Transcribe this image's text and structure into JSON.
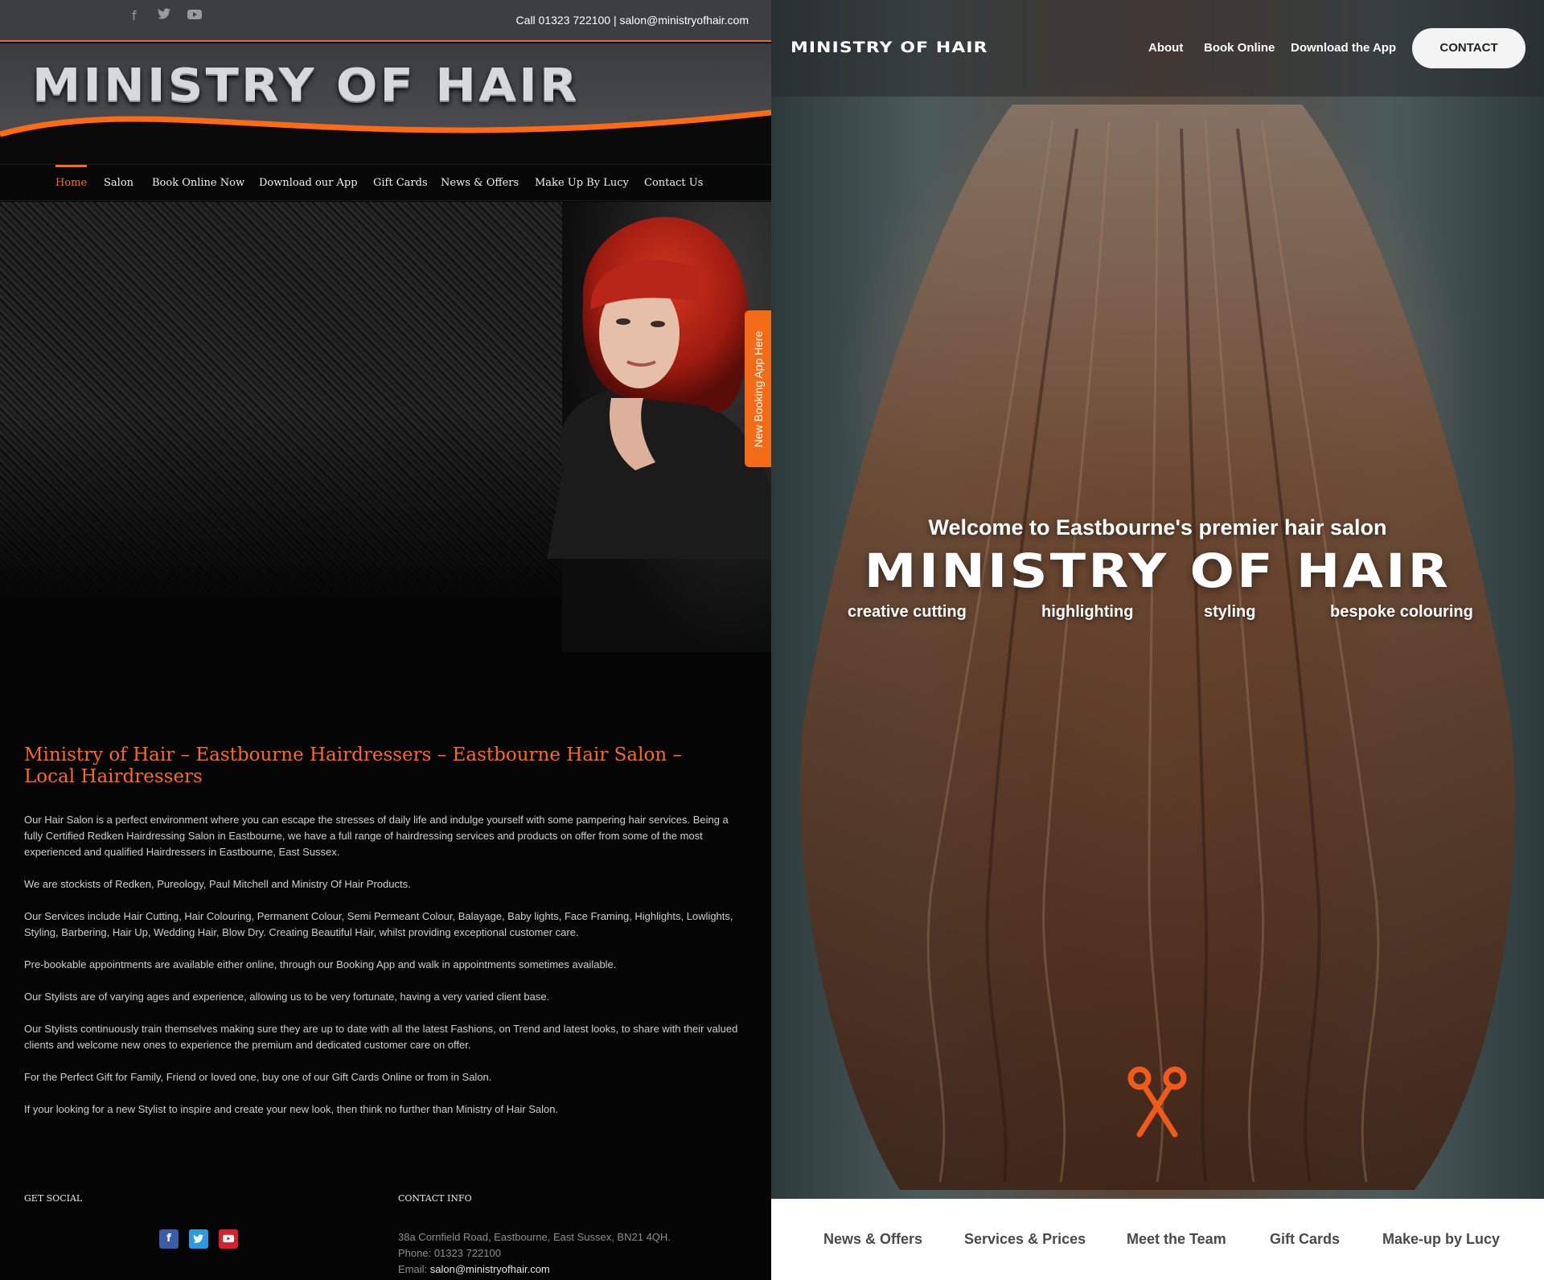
{
  "old_site": {
    "social": [
      "facebook-icon",
      "twitter-icon",
      "youtube-icon"
    ],
    "top_contact": "Call 01323 722100  |  salon@ministryofhair.com",
    "logo": "MINISTRY OF HAIR",
    "nav": [
      "Home",
      "Salon",
      "Book Online Now",
      "Download our App",
      "Gift Cards",
      "News & Offers",
      "Make Up By Lucy",
      "Contact Us"
    ],
    "booking_tab": "New Booking App Here",
    "heading": "Ministry of Hair – Eastbourne Hairdressers – Eastbourne Hair Salon – Local Hairdressers",
    "paragraphs": [
      "Our Hair Salon is a perfect environment where you can escape the stresses of daily life and indulge yourself with some pampering hair services. Being a fully Certified Redken Hairdressing Salon in Eastbourne, we have a full range of hairdressing services and products on offer from some of the most experienced and qualified Hairdressers in Eastbourne, East Sussex.",
      "We are stockists of Redken, Pureology, Paul Mitchell and Ministry Of Hair Products.",
      "Our Services include Hair Cutting, Hair Colouring, Permanent Colour, Semi Permeant Colour, Balayage, Baby lights, Face Framing, Highlights, Lowlights, Styling, Barbering, Hair Up, Wedding Hair, Blow Dry. Creating Beautiful Hair, whilst providing exceptional customer care.",
      "Pre-bookable appointments are available either online, through our Booking App and walk in appointments sometimes available.",
      "Our Stylists are of varying ages and experience, allowing us to be very fortunate, having a very varied client base.",
      "Our Stylists continuously train themselves making sure they are up to date with all the latest Fashions, on Trend and latest looks, to share with their valued clients and welcome new ones to experience the premium and dedicated customer care on offer.",
      "For the Perfect Gift for Family, Friend or loved one, buy one of our Gift Cards Online or from in Salon.",
      "If your looking for a new Stylist to inspire and create your new look, then think no further than Ministry of Hair Salon."
    ],
    "footer": {
      "social_heading": "GET SOCIAL",
      "contact_heading": "CONTACT INFO",
      "address": "38a Cornfield Road, Eastbourne, East Sussex, BN21 4QH.",
      "phone": "Phone: 01323 722100",
      "email_label": "Email: ",
      "email": "salon@ministryofhair.com"
    }
  },
  "new_site": {
    "logo": "MINISTRY OF HAIR",
    "nav": [
      "About",
      "Book Online",
      "Download the App"
    ],
    "contact_button": "CONTACT",
    "welcome": "Welcome to Eastbourne's premier hair salon",
    "title": "MINISTRY OF HAIR",
    "services": [
      "creative cutting",
      "highlighting",
      "styling",
      "bespoke colouring"
    ],
    "footer_nav": [
      "News & Offers",
      "Services & Prices",
      "Meet the Team",
      "Gift Cards",
      "Make-up by Lucy"
    ],
    "accent_color": "#f05a1a"
  }
}
